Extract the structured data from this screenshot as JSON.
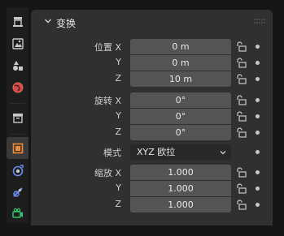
{
  "panel": {
    "title": "变换"
  },
  "location": {
    "label_x": "位置 X",
    "label_y": "Y",
    "label_z": "Z",
    "x": "0 m",
    "y": "0 m",
    "z": "10 m"
  },
  "rotation": {
    "label_x": "旋转 X",
    "label_y": "Y",
    "label_z": "Z",
    "x": "0°",
    "y": "0°",
    "z": "0°"
  },
  "mode": {
    "label": "模式",
    "value": "XYZ 欧拉"
  },
  "scale": {
    "label_x": "缩放 X",
    "label_y": "Y",
    "label_z": "Z",
    "x": "1.000",
    "y": "1.000",
    "z": "1.000"
  },
  "icons": {
    "tabs": [
      "tool-icon",
      "render-icon",
      "output-icon",
      "view-layer-icon",
      "scene-icon",
      "world-icon",
      "collection-icon",
      "object-icon",
      "modifier-icon",
      "particles-icon",
      "physics-icon",
      "object-data-camera-icon"
    ],
    "active_tab": "object-icon"
  },
  "colors": {
    "panel_bg": "#303030",
    "field_bg": "#545454",
    "object_tab_orange": "#f08a2e",
    "modifier_blue": "#6c8ef0",
    "camera_green": "#31c56d",
    "world_red": "#d64848"
  }
}
